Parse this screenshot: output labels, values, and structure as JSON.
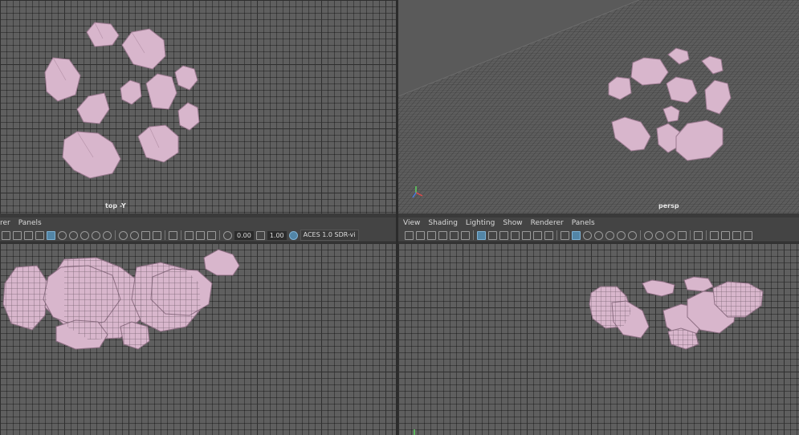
{
  "viewports": {
    "top_left": {
      "camera_label": "top -Y"
    },
    "top_right": {
      "camera_label": "persp"
    }
  },
  "left_panel": {
    "menu": [
      "rer",
      "Panels"
    ],
    "toolbar": {
      "near_value": "0.00",
      "far_value": "1.00",
      "color_space": "ACES 1.0 SDR-vi"
    }
  },
  "right_panel": {
    "menu": [
      "View",
      "Shading",
      "Lighting",
      "Show",
      "Renderer",
      "Panels"
    ]
  },
  "colors": {
    "rock_fill": "#d8b6cc",
    "rock_edge": "#9b7a90",
    "grid_bg": "#5f5f5f",
    "ui_bg": "#444444"
  }
}
